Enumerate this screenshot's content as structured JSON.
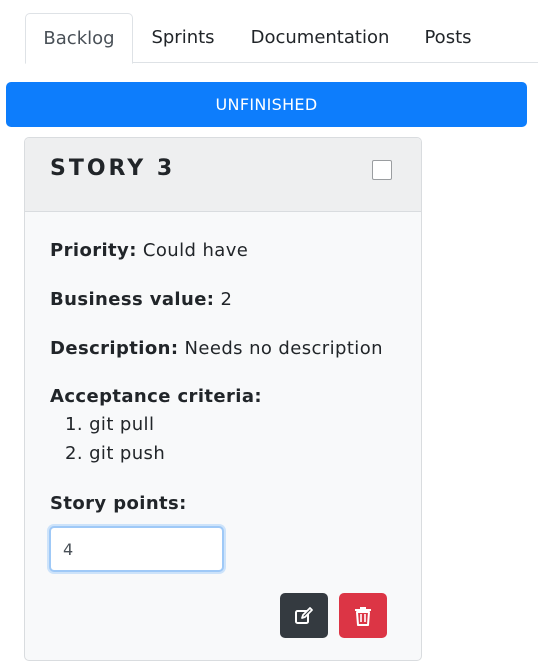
{
  "tabs": {
    "backlog": "Backlog",
    "sprints": "Sprints",
    "documentation": "Documentation",
    "posts": "Posts",
    "active": "Backlog"
  },
  "status_bar": {
    "label": "UNFINISHED",
    "color": "#0d7dfc"
  },
  "story": {
    "title": "STORY 3",
    "checked": false,
    "priority_label": "Priority:",
    "priority_value": "Could have",
    "business_value_label": "Business value:",
    "business_value_value": "2",
    "description_label": "Description:",
    "description_value": "Needs no description",
    "acceptance_criteria_label": "Acceptance criteria:",
    "acceptance_criteria": [
      "git pull",
      "git push"
    ],
    "story_points_label": "Story points:",
    "story_points_value": "4"
  },
  "actions": {
    "edit_icon": "edit-icon",
    "edit_color": "#343a40",
    "delete_icon": "trash-icon",
    "delete_color": "#dc3545"
  }
}
